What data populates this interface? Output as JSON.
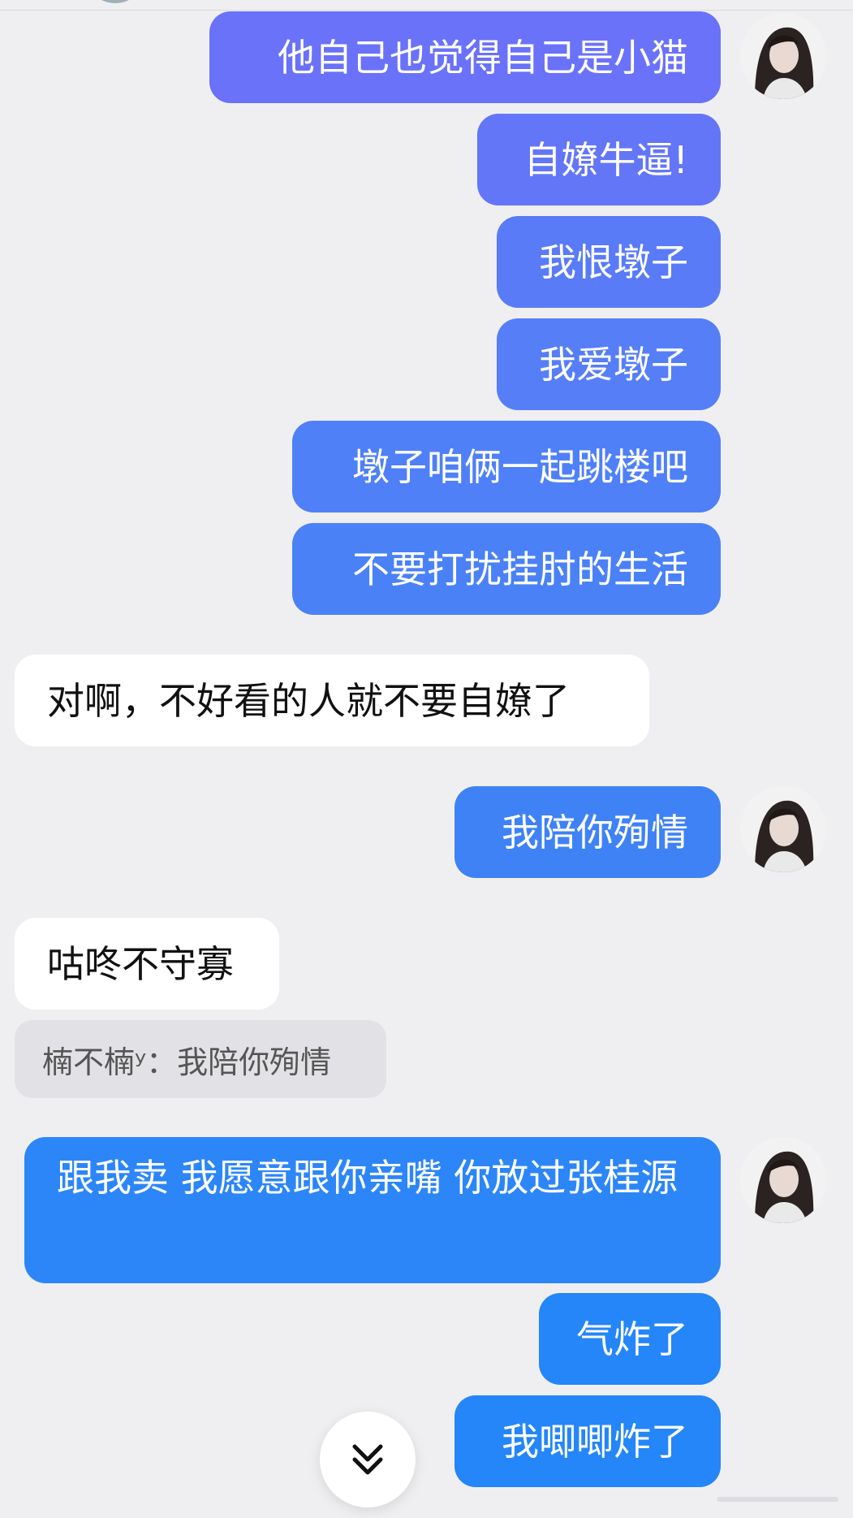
{
  "colors": {
    "background": "#efeff2",
    "outgoing_purple": "#6a72fa",
    "outgoing_blue_violet": "#5a7bf7",
    "outgoing_blue": "#3f82f6",
    "outgoing_bright_blue": "#2486f8",
    "incoming": "#ffffff",
    "quote": "#e2e2e6"
  },
  "messages": [
    {
      "side": "out",
      "text": "他自己也觉得自己是小猫",
      "avatar": true
    },
    {
      "side": "out",
      "text": "自嫽牛逼!"
    },
    {
      "side": "out",
      "text": "我恨墩子"
    },
    {
      "side": "out",
      "text": "我爱墩子"
    },
    {
      "side": "out",
      "text": "墩子咱俩一起跳楼吧"
    },
    {
      "side": "out",
      "text": "不要打扰挂肘的生活"
    },
    {
      "side": "in",
      "text": "对啊，不好看的人就不要自嫽了"
    },
    {
      "side": "out",
      "text": "我陪你殉情",
      "avatar": true
    },
    {
      "side": "in",
      "text": "咕咚不守寡"
    },
    {
      "side": "quote",
      "text": "楠不楠ʸ：我陪你殉情"
    },
    {
      "side": "out",
      "text": "跟我卖 我愿意跟你亲嘴 你放过张桂源",
      "avatar": true
    },
    {
      "side": "out",
      "text": "气炸了"
    },
    {
      "side": "out",
      "text": "我唧唧炸了"
    }
  ],
  "scroll_button": {
    "icon": "double-chevron-down-icon"
  },
  "avatar": {
    "icon": "user-avatar-photo"
  }
}
